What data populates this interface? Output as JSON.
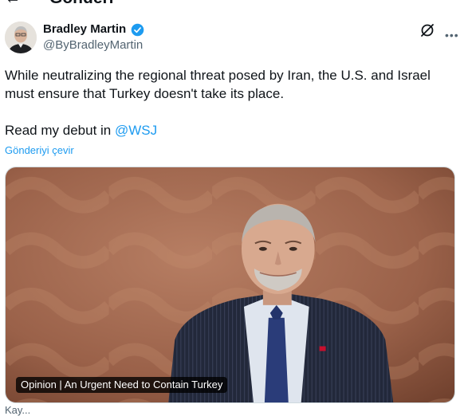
{
  "header": {
    "back_icon": "arrow-left-icon",
    "title": "Gönderi"
  },
  "author": {
    "name": "Bradley Martin",
    "handle": "@ByBradleyMartin",
    "verified_color": "#1d9bf0"
  },
  "tweet": {
    "text": "While neutralizing the regional threat posed by Iran, the U.S. and Israel must ensure that Turkey doesn't take its place.",
    "debut_prefix": "Read my debut in ",
    "mention": "@WSJ",
    "translate_label": "Gönderiyi çevir"
  },
  "card": {
    "label": "Opinion | An Urgent Need to Contain Turkey"
  },
  "colors": {
    "accent": "#1d9bf0",
    "text": "#0f1419",
    "secondary": "#536471"
  },
  "footer": {
    "cut_text": "Kay..."
  }
}
